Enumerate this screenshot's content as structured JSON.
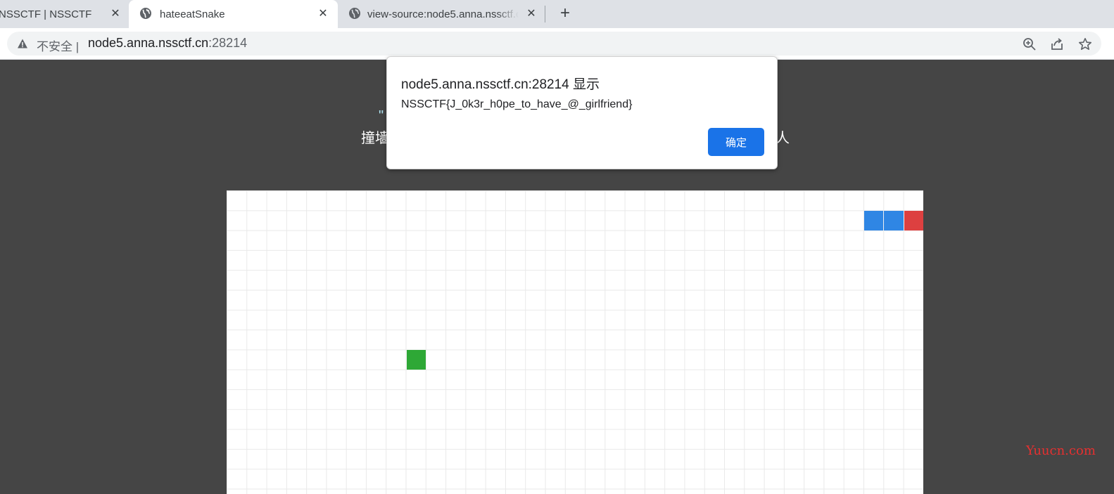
{
  "browser": {
    "tabs": [
      {
        "title": "NSSCTF | NSSCTF",
        "active": false
      },
      {
        "title": "hateeatSnake",
        "active": true
      },
      {
        "title": "view-source:node5.anna.nssctf.cn:28214",
        "active": false
      }
    ],
    "close_glyph": "✕",
    "new_tab_glyph": "+"
  },
  "address_bar": {
    "security_label": "不安全 |",
    "url_host": "node5.anna.nssctf.cn",
    "url_port": ":28214"
  },
  "page": {
    "heading_line1": "\"",
    "heading_line2_left": "撞墙",
    "heading_line2_right": "人",
    "snake": {
      "grid_cols": 35,
      "grid_rows": 16,
      "body_color": "#2f86e4",
      "head_color": "#dd4040",
      "food_color": "#2ea836",
      "segments": [
        {
          "col": 32,
          "row": 1,
          "part": "body"
        },
        {
          "col": 33,
          "row": 1,
          "part": "body"
        },
        {
          "col": 34,
          "row": 1,
          "part": "head"
        }
      ],
      "food": {
        "col": 9,
        "row": 8
      }
    }
  },
  "dialog": {
    "title": "node5.anna.nssctf.cn:28214 显示",
    "message": "NSSCTF{J_0k3r_h0pe_to_have_@_girlfriend}",
    "ok_label": "确定"
  },
  "watermark": "Yuucn.com"
}
